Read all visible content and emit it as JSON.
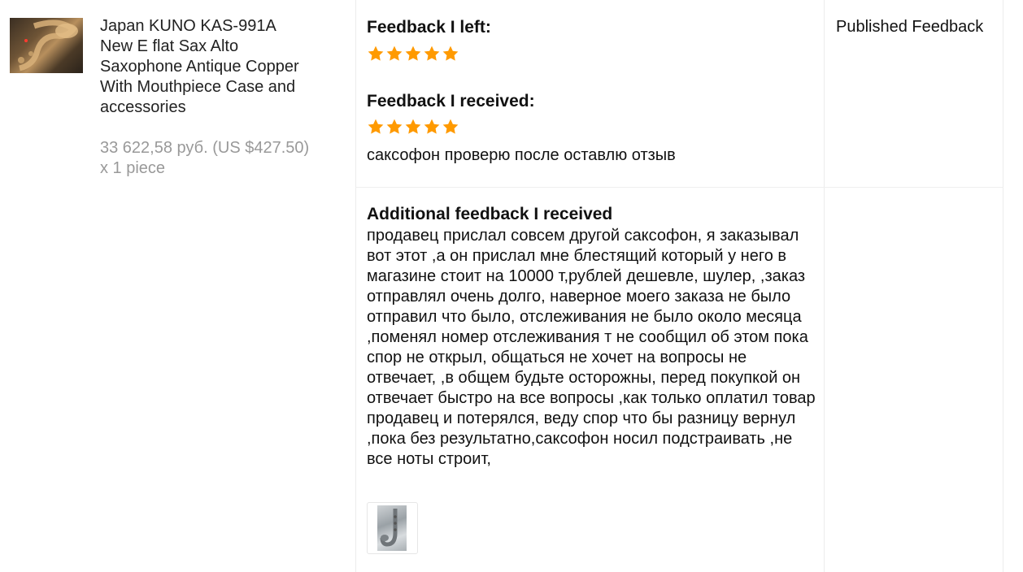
{
  "product": {
    "title": "Japan KUNO KAS-991A New E flat Sax Alto Saxophone Antique Copper With Mouthpiece Case and accessories",
    "price": "33 622,58 руб. (US $427.50) x 1 piece",
    "thumbnail_icon": "saxophone-image"
  },
  "feedback": {
    "left_heading": "Feedback I left:",
    "left_rating": 5,
    "received_heading": "Feedback I received:",
    "received_rating": 5,
    "received_comment": "саксофон проверю после оставлю отзыв",
    "star_color": "#ff9a00"
  },
  "additional": {
    "heading": "Additional feedback I received",
    "text": "продавец прислал совсем другой саксофон, я заказывал вот этот ,а он прислал мне блестящий который у него в магазине стоит на 10000 т,рублей дешевле, шулер, ,заказ отправлял очень долго, наверное моего заказа не было отправил что было, отслеживания не было около месяца ,поменял номер отслеживания т не сообщил об этом пока спор не открыл, общаться не хочет на вопросы не отвечает, ,в общем будьте осторожны, перед покупкой он отвечает быстро на все вопросы ,как только оплатил товар продавец и потерялся, веду спор что бы разницу вернул ,пока без результатно,саксофон носил подстраивать ,не все ноты строит,",
    "attachment_icon": "saxophone-photo"
  },
  "status": {
    "label": "Published Feedback"
  }
}
